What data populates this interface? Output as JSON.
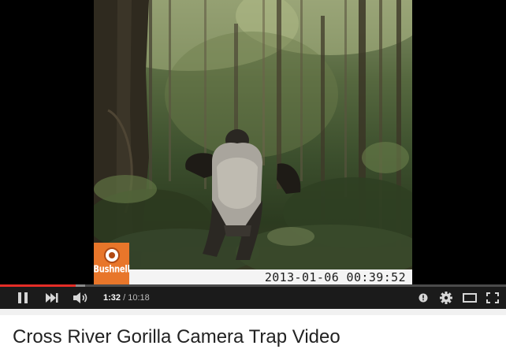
{
  "video": {
    "brand_logo_text": "Bushnell",
    "timestamp_overlay": "2013-01-06 00:39:52"
  },
  "player": {
    "current_time": "1:32",
    "separator": " / ",
    "duration": "10:18",
    "progress_fraction": 0.149,
    "buffered_fraction": 0.168,
    "colors": {
      "progress": "#e52d27",
      "bar": "#1b1b1b"
    },
    "icons": [
      "play-icon",
      "next-icon",
      "volume-icon",
      "annotations-icon",
      "settings-icon",
      "theater-mode-icon",
      "fullscreen-icon"
    ]
  },
  "page": {
    "video_title": "Cross River Gorilla Camera Trap Video"
  }
}
